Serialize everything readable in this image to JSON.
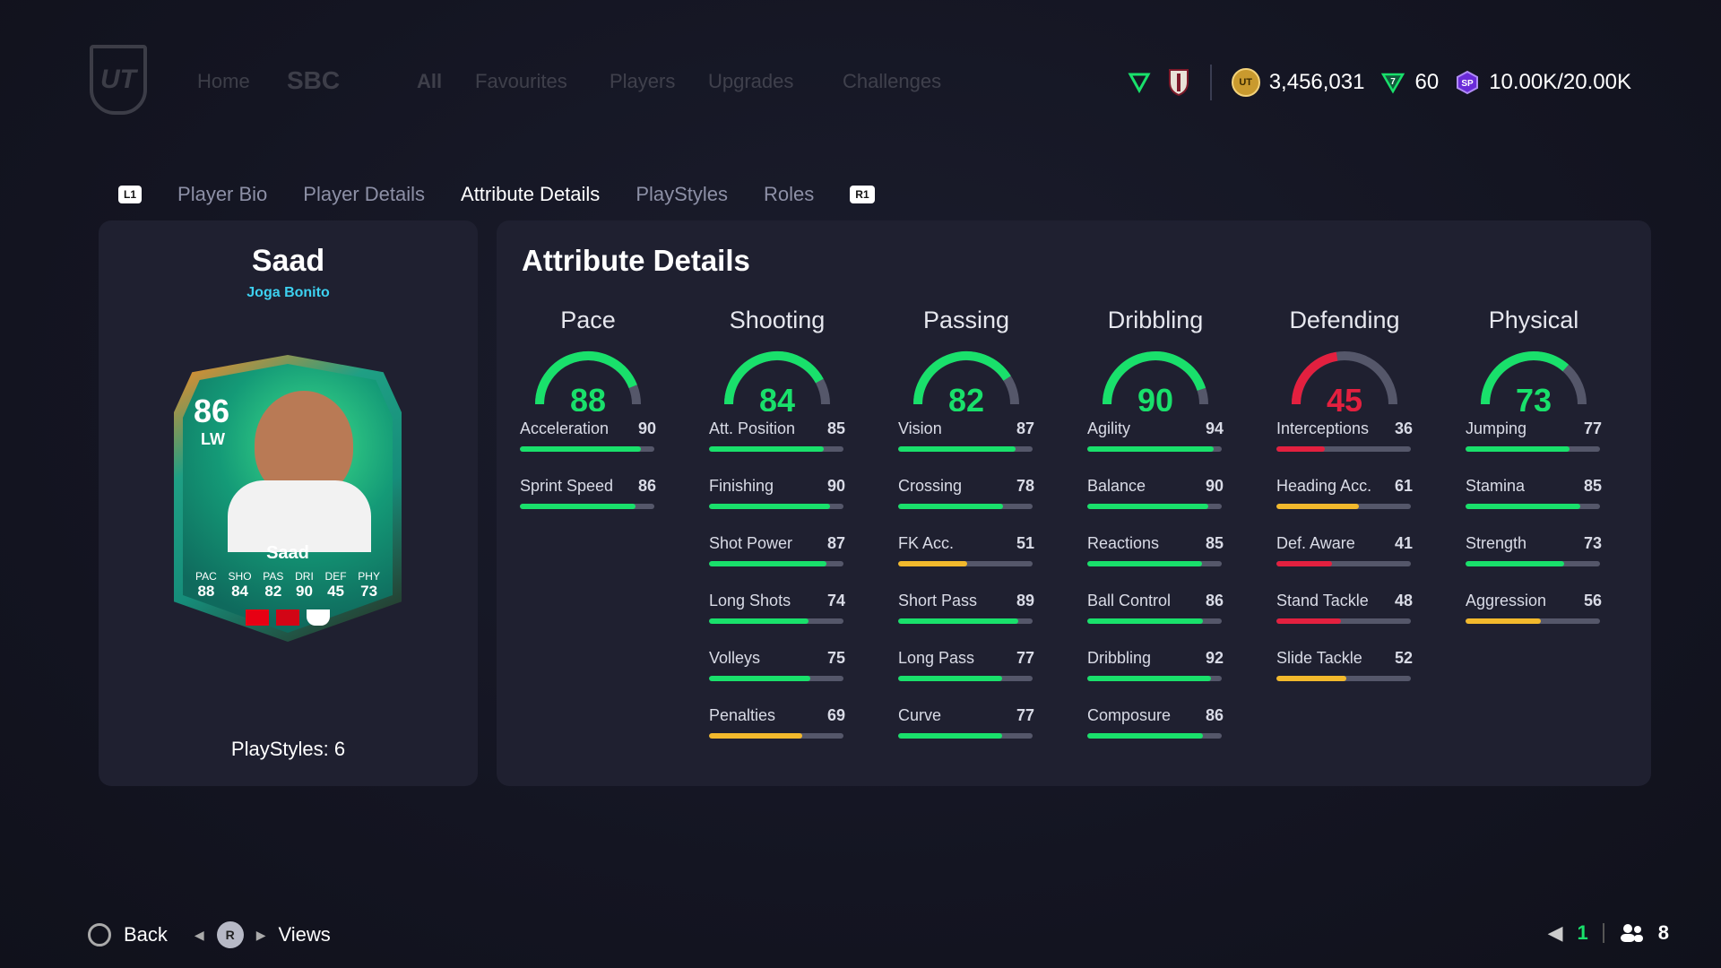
{
  "background_nav": {
    "logo": "UT",
    "items": [
      "Home",
      "SBC",
      "All",
      "Favourites",
      "Players",
      "Upgrades",
      "Challenges"
    ]
  },
  "currency": {
    "coins": "3,456,031",
    "points": "60",
    "sp": "10.00K/20.00K"
  },
  "tabs": {
    "left_button": "L1",
    "right_button": "R1",
    "items": [
      "Player Bio",
      "Player Details",
      "Attribute Details",
      "PlayStyles",
      "Roles"
    ],
    "active": "Attribute Details"
  },
  "player": {
    "name": "Saad",
    "version": "Joga Bonito",
    "playstyles_label": "PlayStyles: 6",
    "card": {
      "rating": "86",
      "position": "LW",
      "name": "Saad",
      "stats": [
        {
          "label": "PAC",
          "value": "88"
        },
        {
          "label": "SHO",
          "value": "84"
        },
        {
          "label": "PAS",
          "value": "82"
        },
        {
          "label": "DRI",
          "value": "90"
        },
        {
          "label": "DEF",
          "value": "45"
        },
        {
          "label": "PHY",
          "value": "73"
        }
      ]
    }
  },
  "attributes": {
    "title": "Attribute Details",
    "colors": {
      "green": "#19e06b",
      "yellow": "#f2b92c",
      "red": "#e3203f",
      "track": "#55576a"
    },
    "categories": [
      {
        "name": "Pace",
        "value": 88,
        "subs": [
          {
            "label": "Acceleration",
            "value": 90
          },
          {
            "label": "Sprint Speed",
            "value": 86
          }
        ]
      },
      {
        "name": "Shooting",
        "value": 84,
        "subs": [
          {
            "label": "Att. Position",
            "value": 85
          },
          {
            "label": "Finishing",
            "value": 90
          },
          {
            "label": "Shot Power",
            "value": 87
          },
          {
            "label": "Long Shots",
            "value": 74
          },
          {
            "label": "Volleys",
            "value": 75
          },
          {
            "label": "Penalties",
            "value": 69
          }
        ]
      },
      {
        "name": "Passing",
        "value": 82,
        "subs": [
          {
            "label": "Vision",
            "value": 87
          },
          {
            "label": "Crossing",
            "value": 78
          },
          {
            "label": "FK Acc.",
            "value": 51
          },
          {
            "label": "Short Pass",
            "value": 89
          },
          {
            "label": "Long Pass",
            "value": 77
          },
          {
            "label": "Curve",
            "value": 77
          }
        ]
      },
      {
        "name": "Dribbling",
        "value": 90,
        "subs": [
          {
            "label": "Agility",
            "value": 94
          },
          {
            "label": "Balance",
            "value": 90
          },
          {
            "label": "Reactions",
            "value": 85
          },
          {
            "label": "Ball Control",
            "value": 86
          },
          {
            "label": "Dribbling",
            "value": 92
          },
          {
            "label": "Composure",
            "value": 86
          }
        ]
      },
      {
        "name": "Defending",
        "value": 45,
        "subs": [
          {
            "label": "Interceptions",
            "value": 36
          },
          {
            "label": "Heading Acc.",
            "value": 61
          },
          {
            "label": "Def. Aware",
            "value": 41
          },
          {
            "label": "Stand Tackle",
            "value": 48
          },
          {
            "label": "Slide Tackle",
            "value": 52
          }
        ]
      },
      {
        "name": "Physical",
        "value": 73,
        "subs": [
          {
            "label": "Jumping",
            "value": 77
          },
          {
            "label": "Stamina",
            "value": 85
          },
          {
            "label": "Strength",
            "value": 73
          },
          {
            "label": "Aggression",
            "value": 56
          }
        ]
      }
    ]
  },
  "footer": {
    "back_label": "Back",
    "views_label": "Views",
    "views_button": "R",
    "count_a": "1",
    "count_b": "8"
  }
}
